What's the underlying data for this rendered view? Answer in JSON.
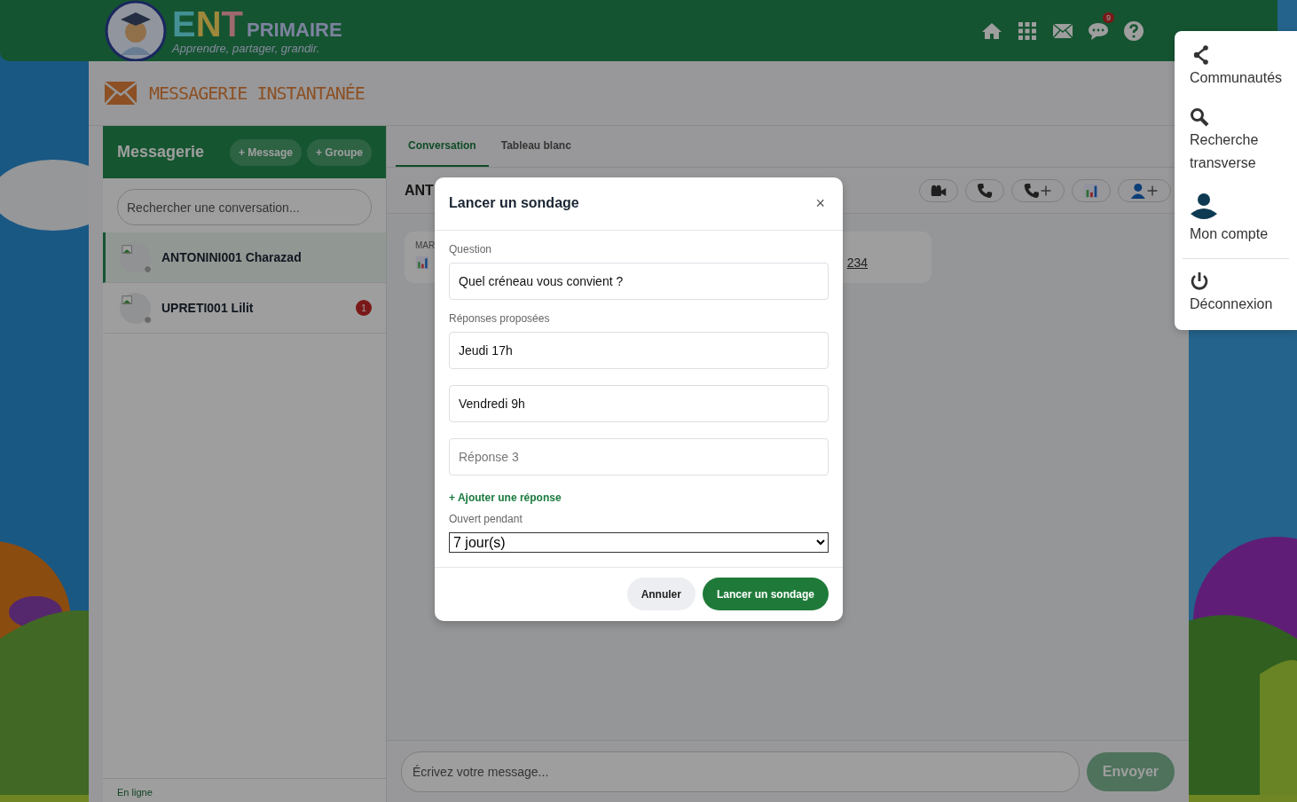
{
  "header": {
    "logo_name": "ENT",
    "logo_word": "PRIMAIRE",
    "tagline": "Apprendre, partager, grandir.",
    "notifications_badge": "9"
  },
  "page_title": "MESSAGERIE INSTANTANÉE",
  "sidebar": {
    "title": "Messagerie",
    "buttons": [
      "+ Message",
      "+ Groupe"
    ],
    "search": {
      "placeholder": "Rechercher une conversation..."
    },
    "conversations": [
      {
        "name": "ANTONINI001 Charazad",
        "selected": true
      },
      {
        "name": "UPRETI001 Lilit",
        "selected": false,
        "unread": "1"
      }
    ],
    "status": "En ligne"
  },
  "chat": {
    "tabs": [
      {
        "label": "Conversation",
        "selected": true
      },
      {
        "label": "Tableau blanc",
        "selected": false
      }
    ],
    "contact_name": "ANT",
    "message": {
      "label": "MAR",
      "link": "234"
    },
    "composer": {
      "placeholder": "Écrivez votre message..."
    },
    "send_button": "Envoyer"
  },
  "modal": {
    "title": "Lancer un sondage",
    "close": "×",
    "question_label": "Question",
    "question": "Quel créneau vous convient ?",
    "answers_label": "Réponses proposées",
    "answers": [
      {
        "value": "Jeudi 17h"
      },
      {
        "value": "Vendredi 9h"
      },
      {
        "placeholder": "Réponse 3"
      }
    ],
    "add_answer": "+ Ajouter une réponse",
    "duration_label": "Ouvert pendant",
    "duration": "7 jour(s)",
    "cancel": "Annuler",
    "submit": "Lancer un sondage"
  },
  "menu": {
    "items": [
      {
        "label": "Communautés",
        "kind": "share",
        "divider_before": false
      },
      {
        "label": "Recherche transverse",
        "kind": "search",
        "divider_before": false
      },
      {
        "label": "Mon compte",
        "kind": "user",
        "divider_before": false
      },
      {
        "label": "Déconnexion",
        "kind": "power",
        "divider_before": true
      }
    ]
  }
}
